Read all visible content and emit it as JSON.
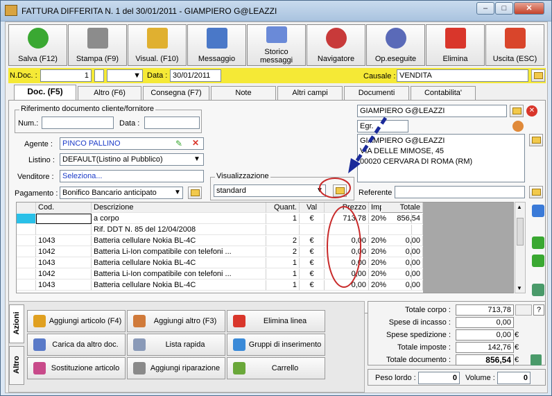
{
  "window": {
    "title": "FATTURA DIFFERITA N. 1  del 30/01/2011 - GIAMPIERO G@LEAZZI"
  },
  "toolbar": [
    {
      "label": "Salva (F12)",
      "icon": "check-icon",
      "color": "#3aa832"
    },
    {
      "label": "Stampa (F9)",
      "icon": "printer-icon",
      "color": "#8c8c8c"
    },
    {
      "label": "Visual. (F10)",
      "icon": "magic-wand-icon",
      "color": "#e0b030"
    },
    {
      "label": "Messaggio",
      "icon": "envelope-pen-icon",
      "color": "#4a78c8"
    },
    {
      "label": "Storico messaggi",
      "icon": "envelope-search-icon",
      "color": "#6a8ad8"
    },
    {
      "label": "Navigatore",
      "icon": "compass-icon",
      "color": "#c83a3a"
    },
    {
      "label": "Op.eseguite",
      "icon": "gears-icon",
      "color": "#5a6ab8"
    },
    {
      "label": "Elimina",
      "icon": "red-x-icon",
      "color": "#d9362b"
    },
    {
      "label": "Uscita (ESC)",
      "icon": "exit-icon",
      "color": "#d9452b"
    }
  ],
  "header": {
    "ndoc_label": "N.Doc. :",
    "ndoc_value": "1",
    "data_label": "Data :",
    "data_value": "30/01/2011",
    "causale_label": "Causale :",
    "causale_value": "VENDITA"
  },
  "tabs": [
    "Doc. (F5)",
    "Altro (F6)",
    "Consegna (F7)",
    "Note",
    "Altri campi",
    "Documenti",
    "Contabilita'"
  ],
  "riferimento": {
    "label": "Riferimento documento cliente/fornitore",
    "num_label": "Num.:",
    "num_value": "",
    "data_label": "Data :",
    "data_value": ""
  },
  "form": {
    "agente_label": "Agente :",
    "agente_value": "PINCO PALLINO",
    "listino_label": "Listino :",
    "listino_value": "DEFAULT(Listino al Pubblico)",
    "venditore_label": "Venditore :",
    "venditore_value": "Seleziona...",
    "pagamento_label": "Pagamento :",
    "pagamento_value": "Bonifico Bancario anticipato",
    "visualizzazione_label": "Visualizzazione",
    "visualizzazione_value": "standard"
  },
  "cliente": {
    "nome": "GIAMPIERO G@LEAZZI",
    "titolo": "Egr.",
    "indirizzo": [
      "GIAMPIERO G@LEAZZI",
      "VIA DELLE MIMOSE, 45",
      "00020 CERVARA DI ROMA (RM)"
    ],
    "referente_label": "Referente",
    "referente_value": ""
  },
  "grid": {
    "columns": [
      "Cod.",
      "Descrizione",
      "Quant.",
      "Val",
      "Prezzo",
      "Imposte",
      "Totale"
    ],
    "rows": [
      [
        "",
        "a corpo",
        "1",
        "€",
        "713,78",
        "20%",
        "856,54"
      ],
      [
        "",
        "Rif. DDT N. 85 del 12/04/2008",
        "",
        "",
        "",
        "",
        ""
      ],
      [
        "1043",
        "Batteria cellulare Nokia BL-4C",
        "2",
        "€",
        "0,00",
        "20%",
        "0,00"
      ],
      [
        "1042",
        "Batteria Li-Ion compatibile con telefoni ...",
        "2",
        "€",
        "0,00",
        "20%",
        "0,00"
      ],
      [
        "1043",
        "Batteria cellulare Nokia BL-4C",
        "1",
        "€",
        "0,00",
        "20%",
        "0,00"
      ],
      [
        "1042",
        "Batteria Li-Ion compatibile con telefoni ...",
        "1",
        "€",
        "0,00",
        "20%",
        "0,00"
      ],
      [
        "1043",
        "Batteria cellulare Nokia BL-4C",
        "1",
        "€",
        "0,00",
        "20%",
        "0,00"
      ]
    ]
  },
  "side_tabs": [
    "Azioni",
    "Altro"
  ],
  "actions": [
    {
      "label": "Aggiungi articolo (F4)",
      "icon": "box-add-icon",
      "color": "#e0a020"
    },
    {
      "label": "Aggiungi altro (F3)",
      "icon": "grid-add-icon",
      "color": "#d07a3a"
    },
    {
      "label": "Elimina linea",
      "icon": "red-x-icon",
      "color": "#d9362b"
    },
    {
      "label": "Carica da altro doc.",
      "icon": "checklist-icon",
      "color": "#5a7ac8"
    },
    {
      "label": "Lista rapida",
      "icon": "scroll-add-icon",
      "color": "#8a9ab8"
    },
    {
      "label": "Gruppi di inserimento",
      "icon": "group-add-icon",
      "color": "#3a8ad8"
    },
    {
      "label": "Sostituzione articolo",
      "icon": "shapes-icon",
      "color": "#c84a8a"
    },
    {
      "label": "Aggiungi riparazione",
      "icon": "wrench-icon",
      "color": "#8a8a8a"
    },
    {
      "label": "Carrello",
      "icon": "cart-icon",
      "color": "#6aa83a"
    }
  ],
  "totals": [
    {
      "label": "Totale corpo :",
      "value": "713,78",
      "unit": ""
    },
    {
      "label": "Spese di incasso :",
      "value": "0,00",
      "unit": ""
    },
    {
      "label": "Spese spedizione :",
      "value": "0,00",
      "unit": "€"
    },
    {
      "label": "Totale imposte :",
      "value": "142,76",
      "unit": "€"
    },
    {
      "label": "Totale documento :",
      "value": "856,54",
      "unit": "€"
    }
  ],
  "weights": {
    "peso_label": "Peso lordo :",
    "peso_value": "0",
    "volume_label": "Volume :",
    "volume_value": "0"
  },
  "help_label": "?"
}
